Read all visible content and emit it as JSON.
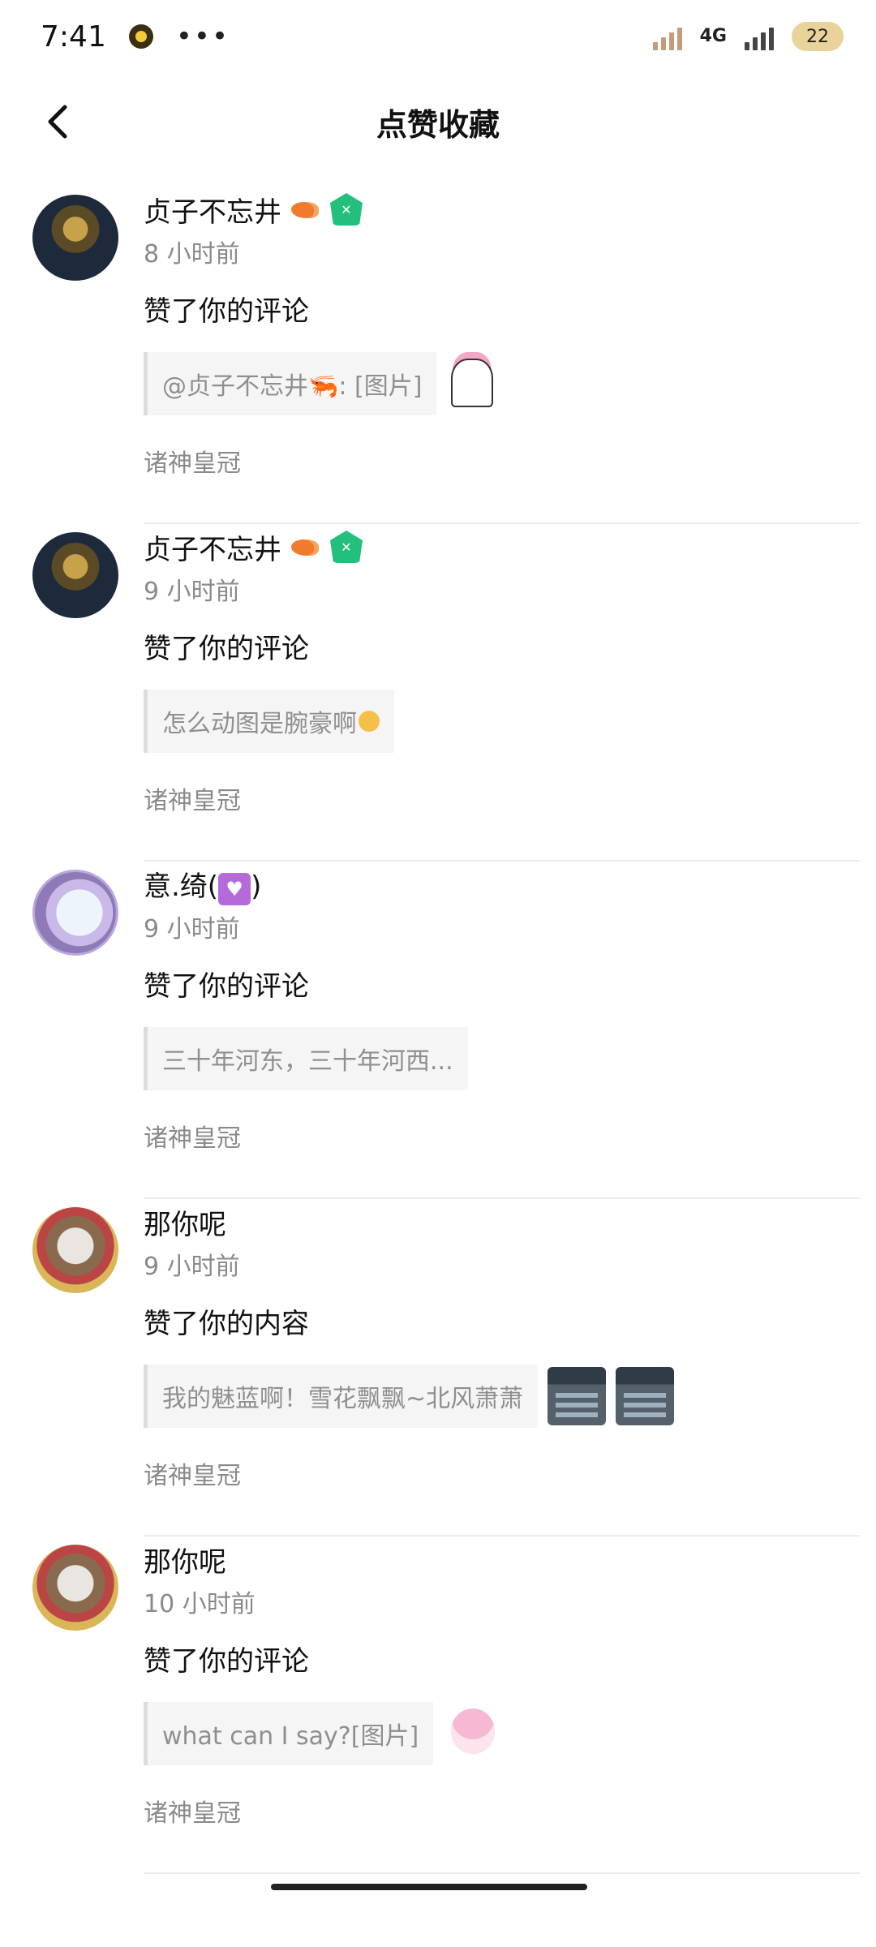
{
  "status_bar": {
    "time": "7:41",
    "dots": "•••",
    "network": "4G",
    "battery": "22"
  },
  "header": {
    "title": "点赞收藏",
    "back_icon": "chevron-left-icon"
  },
  "items": [
    {
      "name": "贞子不忘井",
      "badges": [
        "shrimp-icon",
        "game-badge-icon"
      ],
      "time": "8 小时前",
      "action": "赞了你的评论",
      "quote": "@贞子不忘井🦐: [图片]",
      "forum": "诸神皇冠"
    },
    {
      "name": "贞子不忘井",
      "badges": [
        "shrimp-icon",
        "game-badge-icon"
      ],
      "time": "9 小时前",
      "action": "赞了你的评论",
      "quote": "怎么动图是腕豪啊",
      "forum": "诸神皇冠"
    },
    {
      "name": "意.绮(",
      "name_suffix": ")",
      "time": "9 小时前",
      "action": "赞了你的评论",
      "quote": "三十年河东，三十年河西...",
      "forum": "诸神皇冠"
    },
    {
      "name": "那你呢",
      "time": "9 小时前",
      "action": "赞了你的内容",
      "quote": "我的魅蓝啊！雪花飘飘~北风萧萧",
      "forum": "诸神皇冠"
    },
    {
      "name": "那你呢",
      "time": "10 小时前",
      "action": "赞了你的评论",
      "quote": "what can I say?[图片]",
      "forum": "诸神皇冠"
    }
  ]
}
